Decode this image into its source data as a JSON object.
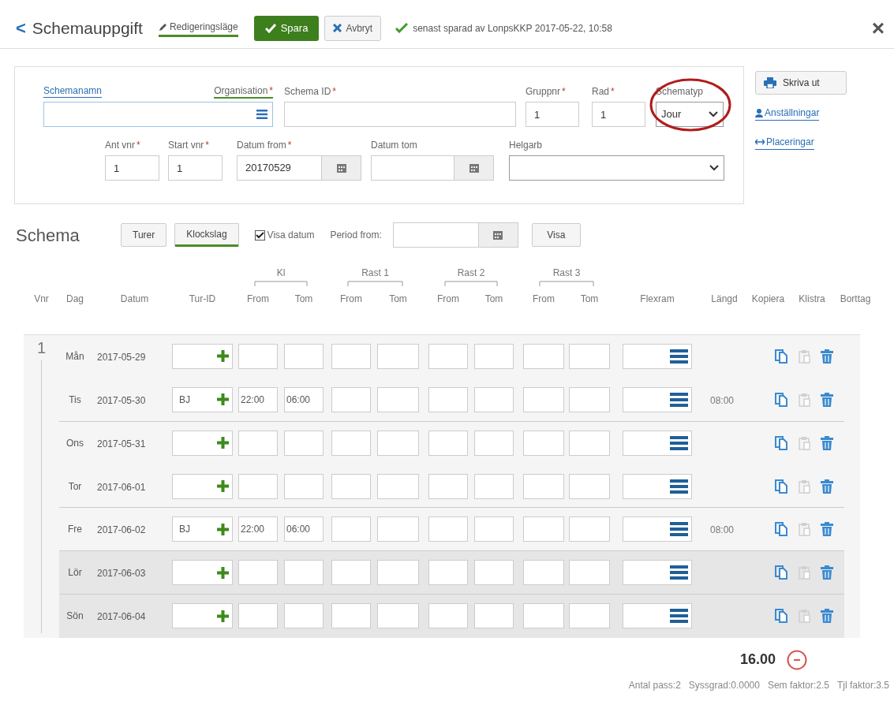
{
  "header": {
    "back": "<",
    "title": "Schemauppgift",
    "mode_link": "Redigeringsläge",
    "save": "Spara",
    "cancel": "Avbryt",
    "status": "senast sparad av LonpsKKP 2017-05-22, 10:58",
    "close": "×"
  },
  "form": {
    "row1": [
      {
        "kind": "lookup",
        "labels": [
          {
            "text": "Schemanamn"
          },
          {
            "text": "Organisation",
            "required_mark": "*"
          }
        ]
      },
      {
        "kind": "text",
        "label": "Schema ID",
        "required_mark": "*"
      },
      {
        "kind": "text",
        "label": "Gruppnr",
        "required_mark": "*",
        "value": "1"
      },
      {
        "kind": "text",
        "label": "Rad",
        "required_mark": "*",
        "value": "1"
      },
      {
        "kind": "select",
        "label": "Schematyp",
        "value": "Jour",
        "annotated": true
      }
    ],
    "row2": [
      {
        "kind": "text",
        "label": "Ant vnr",
        "required_mark": "*",
        "value": "1"
      },
      {
        "kind": "text",
        "label": "Start vnr",
        "required_mark": "*",
        "value": "1"
      },
      {
        "kind": "date",
        "label": "Datum from",
        "required_mark": "*",
        "value": "20170529"
      },
      {
        "kind": "date",
        "label": "Datum tom"
      },
      {
        "kind": "select",
        "label": "Helgarb"
      }
    ]
  },
  "side": {
    "print": "Skriva ut",
    "links": [
      {
        "text": "Anställningar",
        "kind": "person"
      },
      {
        "text": "Placeringar",
        "kind": "arrows"
      }
    ]
  },
  "schema": {
    "title": "Schema",
    "tabs": [
      {
        "label": "Turer",
        "selected": false
      },
      {
        "label": "Klockslag",
        "selected": true
      }
    ],
    "show_dates": {
      "label": "Visa datum",
      "checked": true
    },
    "period_label": "Period from:",
    "show": "Visa"
  },
  "table": {
    "groups": [
      "Kl",
      "Rast 1",
      "Rast 2",
      "Rast 3"
    ],
    "columns": [
      "Vnr",
      "Dag",
      "Datum",
      "Tur-ID",
      "From",
      "Tom",
      "From",
      "Tom",
      "From",
      "Tom",
      "From",
      "Tom",
      "Flexram",
      "Längd",
      "Kopiera",
      "Klistra",
      "Borttag"
    ],
    "vnr": "1",
    "rows": [
      {
        "day": "Mån",
        "date": "2017-05-29",
        "weekend": false,
        "paste_enabled": false
      },
      {
        "day": "Tis",
        "date": "2017-05-30",
        "tur_id": "BJ",
        "kl_from": "22:00",
        "kl_tom": "06:00",
        "length": "08:00",
        "weekend": false,
        "paste_enabled": false
      },
      {
        "day": "Ons",
        "date": "2017-05-31",
        "weekend": false,
        "paste_enabled": false
      },
      {
        "day": "Tor",
        "date": "2017-06-01",
        "weekend": false,
        "paste_enabled": false
      },
      {
        "day": "Fre",
        "date": "2017-06-02",
        "tur_id": "BJ",
        "kl_from": "22:00",
        "kl_tom": "06:00",
        "length": "08:00",
        "weekend": false,
        "paste_enabled": false
      },
      {
        "day": "Lör",
        "date": "2017-06-03",
        "weekend": true,
        "paste_enabled": false
      },
      {
        "day": "Sön",
        "date": "2017-06-04",
        "weekend": true,
        "paste_enabled": false
      }
    ]
  },
  "total": "16.00",
  "stats": [
    "Antal pass:2",
    "Syssgrad:0.0000",
    "Sem faktor:2.5",
    "Tjl faktor:3.5"
  ]
}
